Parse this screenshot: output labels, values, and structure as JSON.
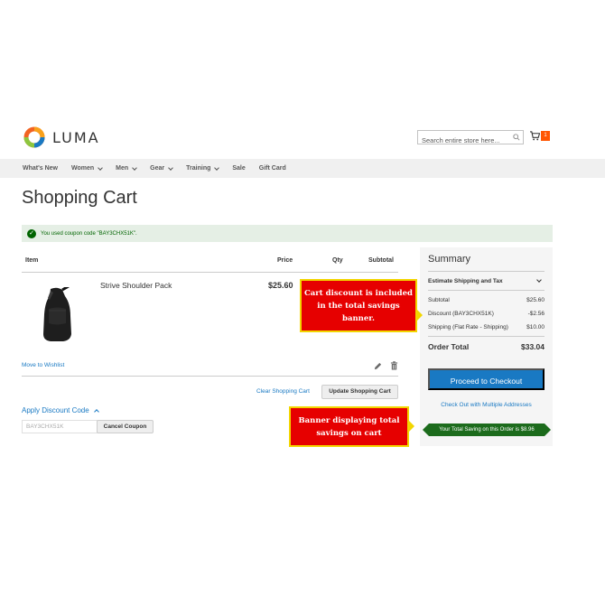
{
  "header": {
    "logo_text": "LUMA",
    "search_placeholder": "Search entire store here...",
    "cart_count": "1"
  },
  "nav": {
    "items": [
      {
        "label": "What's New",
        "has_dropdown": false
      },
      {
        "label": "Women",
        "has_dropdown": true
      },
      {
        "label": "Men",
        "has_dropdown": true
      },
      {
        "label": "Gear",
        "has_dropdown": true
      },
      {
        "label": "Training",
        "has_dropdown": true
      },
      {
        "label": "Sale",
        "has_dropdown": false
      },
      {
        "label": "Gift Card",
        "has_dropdown": false
      }
    ]
  },
  "page": {
    "title": "Shopping Cart"
  },
  "message": {
    "text": "You used coupon code \"BAY3CHX51K\"."
  },
  "cart": {
    "columns": {
      "item": "Item",
      "price": "Price",
      "qty": "Qty",
      "subtotal": "Subtotal"
    },
    "product": {
      "name": "Strive Shoulder Pack",
      "price": "$25.60"
    },
    "move_to_wishlist": "Move to Wishlist",
    "clear_cart": "Clear Shopping Cart",
    "update_cart": "Update Shopping Cart"
  },
  "discount": {
    "title": "Apply Discount Code",
    "code_value": "BAY3CHX51K",
    "cancel_button": "Cancel Coupon"
  },
  "summary": {
    "title": "Summary",
    "estimate_label": "Estimate Shipping and Tax",
    "rows": [
      {
        "label": "Subtotal",
        "value": "$25.60"
      },
      {
        "label": "Discount (BAY3CHX51K)",
        "value": "-$2.56"
      },
      {
        "label": "Shipping (Flat Rate - Shipping)",
        "value": "$10.00"
      }
    ],
    "total_label": "Order Total",
    "total_value": "$33.04",
    "checkout_button": "Proceed to Checkout",
    "multi_address": "Check Out with Multiple Addresses",
    "savings_banner": "Your Total Saving on this Order is $8.96"
  },
  "callouts": {
    "discount_note": "Cart discount is included in the total savings banner.",
    "banner_note": "Banner displaying total savings on cart"
  },
  "colors": {
    "accent_blue": "#1979c3",
    "cart_badge": "#ff5501",
    "success_green": "#006400",
    "callout_red": "#e60000",
    "callout_border": "#f2d600"
  }
}
